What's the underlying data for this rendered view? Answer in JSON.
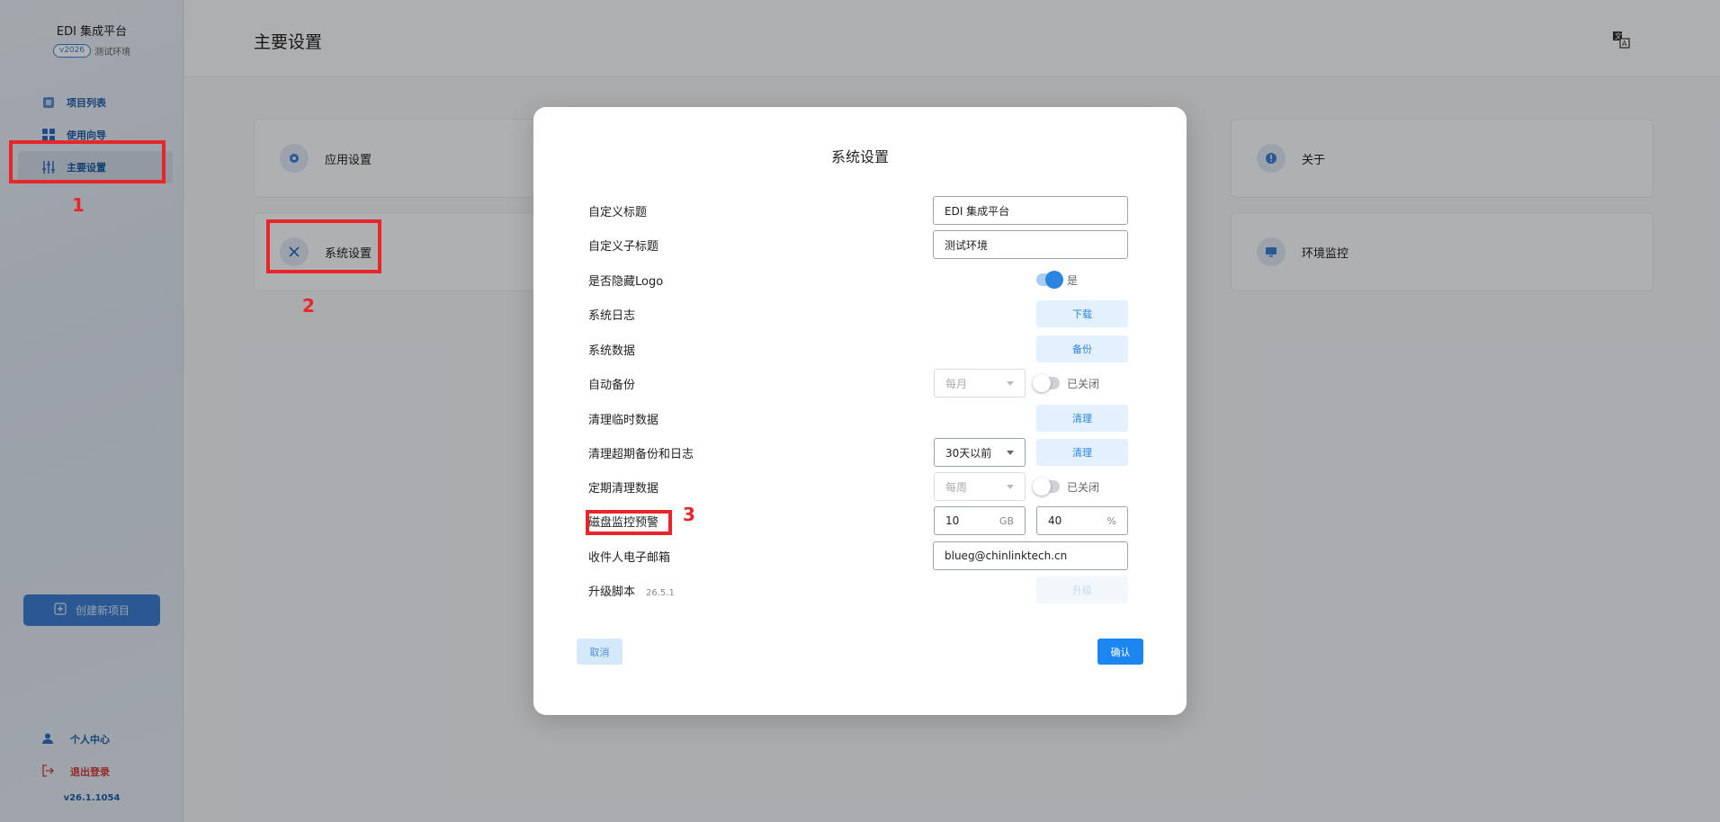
{
  "sidebar": {
    "brand_title": "EDI 集成平台",
    "version_pill": "v2026",
    "env_label": "测试环境",
    "items": [
      {
        "label": "项目列表",
        "icon": "list-icon"
      },
      {
        "label": "使用向导",
        "icon": "grid-icon"
      },
      {
        "label": "主要设置",
        "icon": "sliders-icon",
        "active": true
      }
    ],
    "create_button": "创建新项目",
    "bottom_items": [
      {
        "label": "个人中心",
        "icon": "user-icon"
      },
      {
        "label": "退出登录",
        "icon": "logout-icon"
      }
    ],
    "app_version": "v26.1.1054"
  },
  "header": {
    "title": "主要设置",
    "translate_icon": "translate-icon"
  },
  "cards": [
    {
      "label": "应用设置",
      "icon": "gear-icon"
    },
    {
      "label": "系统设置",
      "icon": "tools-icon"
    },
    {
      "label": "关于",
      "icon": "info-icon"
    },
    {
      "label": "环境监控",
      "icon": "monitor-icon"
    }
  ],
  "dialog": {
    "title": "系统设置",
    "rows": {
      "custom_title": {
        "label": "自定义标题",
        "value": "EDI 集成平台"
      },
      "custom_subtitle": {
        "label": "自定义子标题",
        "value": "测试环境"
      },
      "hide_logo": {
        "label": "是否隐藏Logo",
        "state": "on",
        "state_label": "是"
      },
      "system_log": {
        "label": "系统日志",
        "button": "下载"
      },
      "system_data": {
        "label": "系统数据",
        "button": "备份"
      },
      "auto_backup": {
        "label": "自动备份",
        "select": "每月",
        "state": "off",
        "state_label": "已关闭"
      },
      "clean_temp": {
        "label": "清理临时数据",
        "button": "清理"
      },
      "clean_expired": {
        "label": "清理超期备份和日志",
        "select": "30天以前",
        "button": "清理"
      },
      "scheduled_clean": {
        "label": "定期清理数据",
        "select": "每周",
        "state": "off",
        "state_label": "已关闭"
      },
      "disk_alert": {
        "label": "磁盘监控预警",
        "gb_value": "10",
        "gb_unit": "GB",
        "pct_value": "40",
        "pct_unit": "%"
      },
      "email": {
        "label": "收件人电子邮箱",
        "value": "blueg@chinlinktech.cn"
      },
      "upgrade": {
        "label": "升级脚本",
        "version": "26.5.1",
        "button": "升级"
      }
    },
    "cancel_label": "取消",
    "confirm_label": "确认"
  },
  "annotations": [
    "1",
    "2",
    "3"
  ],
  "colors": {
    "accent": "#2d84e0",
    "primary_button": "#1b86f2",
    "annotation_red": "#e8262a",
    "logout_red": "#d23b3b"
  }
}
